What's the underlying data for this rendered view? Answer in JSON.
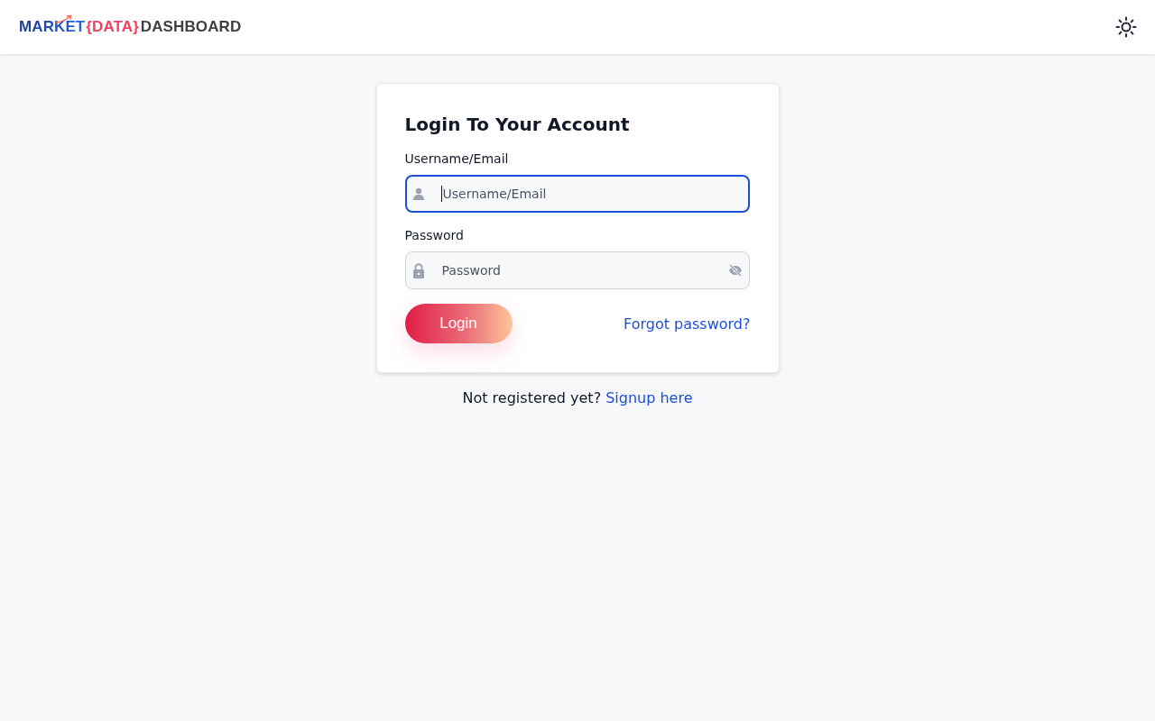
{
  "header": {
    "logo": {
      "parts": [
        "MARKET",
        "{DATA}",
        "DASHBOARD"
      ]
    },
    "theme_toggle": {
      "dark_mode": false
    }
  },
  "login_card": {
    "title": "Login To Your Account",
    "fields": [
      {
        "kind": "username",
        "label": "Username/Email",
        "placeholder": "Username/Email",
        "focused": true
      },
      {
        "kind": "password",
        "label": "Password",
        "placeholder": "Password",
        "focused": false,
        "password_visible": false
      }
    ],
    "login_button": "Login",
    "forgot_link": "Forgot password?"
  },
  "signup": {
    "text": "Not registered yet?",
    "link": "Signup here"
  }
}
